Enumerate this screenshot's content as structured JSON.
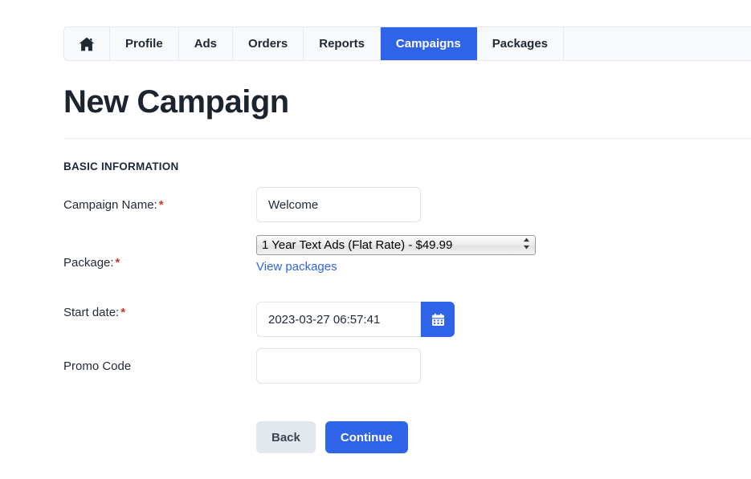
{
  "colors": {
    "accent": "#2f63e8",
    "required_asterisk": "#d93025",
    "back_button_bg": "#e3e8ef",
    "navbar_bg": "#f8fafc",
    "border": "#e3eaf2"
  },
  "navbar": {
    "tabs": [
      {
        "label": "",
        "icon": "home-icon",
        "active": false
      },
      {
        "label": "Profile",
        "active": false
      },
      {
        "label": "Ads",
        "active": false
      },
      {
        "label": "Orders",
        "active": false
      },
      {
        "label": "Reports",
        "active": false
      },
      {
        "label": "Campaigns",
        "active": true
      },
      {
        "label": "Packages",
        "active": false
      }
    ]
  },
  "page": {
    "title": "New Campaign",
    "section_label": "BASIC INFORMATION"
  },
  "form": {
    "fields": [
      {
        "label": "Campaign Name:",
        "required": true,
        "type": "text",
        "value": "Welcome",
        "placeholder": ""
      },
      {
        "label": "Package:",
        "required": true,
        "type": "select",
        "value": "1 Year Text Ads (Flat Rate) - $49.99",
        "options": [
          "1 Year Text Ads (Flat Rate) - $49.99"
        ],
        "link_label": "View packages"
      },
      {
        "label": "Start date:",
        "required": true,
        "type": "datetime",
        "value": "2023-03-27 06:57:41",
        "placeholder": "",
        "button_icon": "calendar-icon"
      },
      {
        "label": "Promo Code",
        "required": false,
        "type": "text",
        "value": "",
        "placeholder": ""
      }
    ]
  },
  "actions": {
    "back_label": "Back",
    "continue_label": "Continue"
  }
}
